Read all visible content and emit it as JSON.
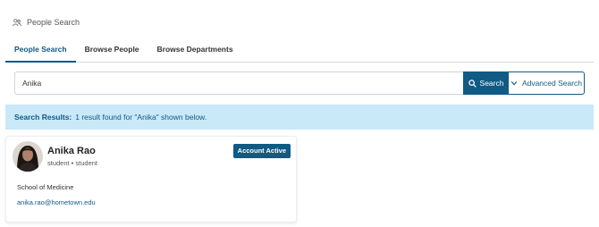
{
  "header": {
    "title": "People Search",
    "icon": "people-icon"
  },
  "tabs": [
    {
      "label": "People Search",
      "active": true
    },
    {
      "label": "Browse People",
      "active": false
    },
    {
      "label": "Browse Departments",
      "active": false
    }
  ],
  "search": {
    "value": "Anika",
    "button_label": "Search",
    "advanced_label": "Advanced Search"
  },
  "results": {
    "label": "Search Results:",
    "message": "1 result found for \"Anika\" shown below."
  },
  "person": {
    "name": "Anika Rao",
    "role": "student • student",
    "status": "Account Active",
    "department": "School of Medicine",
    "email": "anika.rao@hometown.edu"
  },
  "colors": {
    "accent": "#105a86",
    "results_bg": "#c9e8f8"
  }
}
